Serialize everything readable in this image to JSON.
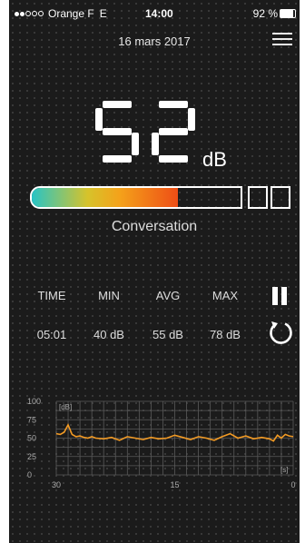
{
  "status": {
    "carrier": "Orange F",
    "network": "E",
    "time": "14:00",
    "battery": "92 %"
  },
  "date": "16 mars 2017",
  "level": {
    "value": "52",
    "unit": "dB",
    "fill": 0.7
  },
  "category": "Conversation",
  "stats": {
    "headers": [
      "TIME",
      "MIN",
      "AVG",
      "MAX"
    ],
    "values": [
      "05:01",
      "40 dB",
      "55 dB",
      "78 dB"
    ]
  },
  "icons": {
    "menu": "menu-icon",
    "pause": "pause-icon",
    "reset": "reset-icon"
  },
  "chart_data": {
    "type": "line",
    "ylabel": "[dB]",
    "xlabel": "[s]",
    "ylim": [
      0,
      100
    ],
    "xlim": [
      30,
      0
    ],
    "y_ticks": [
      "100",
      "75",
      "50",
      "25",
      "0"
    ],
    "x_ticks": [
      "30",
      "15",
      "0"
    ],
    "series": [
      {
        "x": [
          30,
          29.5,
          29,
          28.5,
          28,
          27.5,
          27,
          26.5,
          26,
          25.5,
          25,
          24,
          23,
          22,
          21,
          20,
          19,
          18,
          17,
          16,
          15,
          14,
          13,
          12,
          11,
          10,
          9,
          8,
          7,
          6,
          5,
          4,
          3,
          2.5,
          2,
          1.5,
          1,
          0.5,
          0
        ],
        "values": [
          56,
          55,
          58,
          68,
          55,
          52,
          53,
          51,
          50,
          52,
          50,
          49,
          51,
          47,
          52,
          50,
          48,
          51,
          49,
          50,
          54,
          51,
          48,
          52,
          50,
          47,
          52,
          56,
          50,
          53,
          49,
          51,
          49,
          46,
          54,
          50,
          55,
          53,
          52
        ]
      }
    ]
  }
}
